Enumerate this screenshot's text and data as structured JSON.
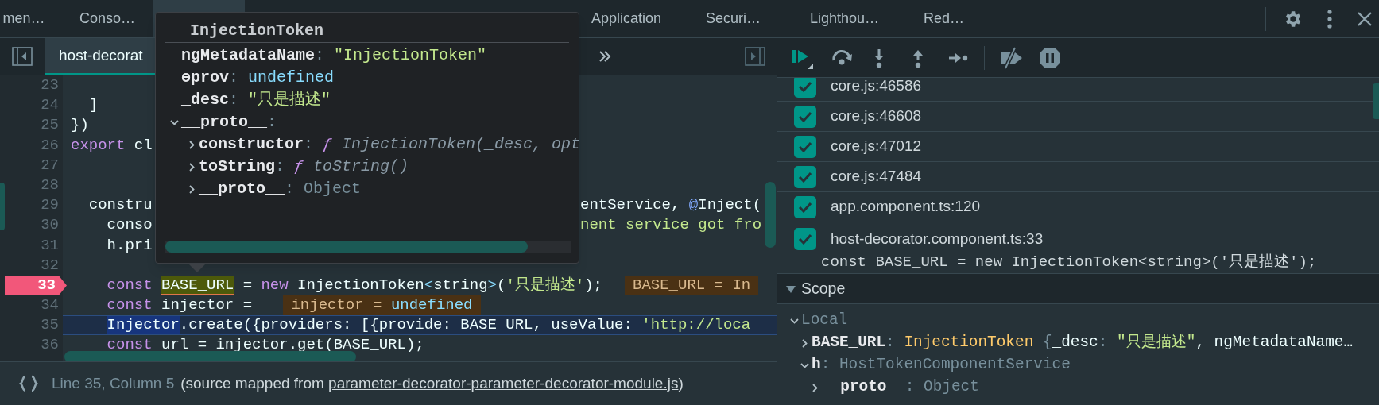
{
  "top_tabs": [
    {
      "label": "men…",
      "selected": false
    },
    {
      "label": "Conso…",
      "selected": false
    },
    {
      "selected": true
    },
    {
      "label": "Application",
      "selected": false
    },
    {
      "label": "Securi…",
      "selected": false
    },
    {
      "label": "Lighthou…",
      "selected": false
    },
    {
      "label": "Red…",
      "selected": false
    }
  ],
  "editor_tabs": [
    {
      "label": "host-decorat",
      "selected": true
    }
  ],
  "code_lines": [
    {
      "number": "23",
      "breakpoint": false,
      "current": false
    },
    {
      "number": "24",
      "breakpoint": false,
      "current": false,
      "segments": [
        {
          "text": "  ]",
          "kind": "plain"
        }
      ]
    },
    {
      "number": "25",
      "breakpoint": false,
      "current": false,
      "segments": [
        {
          "text": "})",
          "kind": "plain"
        }
      ]
    },
    {
      "number": "26",
      "breakpoint": false,
      "current": false,
      "segments": [
        {
          "text": "export",
          "kind": "kw"
        },
        {
          "text": " cl",
          "kind": "plain"
        }
      ]
    },
    {
      "number": "27",
      "breakpoint": false,
      "current": false
    },
    {
      "number": "28",
      "breakpoint": false,
      "current": false
    },
    {
      "number": "29",
      "breakpoint": false,
      "current": false,
      "segments": [
        {
          "text": "  constru",
          "kind": "plain"
        }
      ],
      "right_segments": [
        {
          "text": "entService, ",
          "kind": "plain"
        },
        {
          "text": "@",
          "kind": "deco"
        },
        {
          "text": "Inject(",
          "kind": "plain"
        }
      ]
    },
    {
      "number": "30",
      "breakpoint": false,
      "current": false,
      "segments": [
        {
          "text": "    conso",
          "kind": "plain"
        }
      ],
      "right_segments": [
        {
          "text": "nent service got fro",
          "kind": "str"
        }
      ]
    },
    {
      "number": "31",
      "breakpoint": false,
      "current": false,
      "segments": [
        {
          "text": "    h.pri",
          "kind": "plain"
        }
      ]
    },
    {
      "number": "32",
      "breakpoint": false,
      "current": false
    },
    {
      "number": "33",
      "breakpoint": true,
      "current": false,
      "segments": [
        {
          "text": "    const",
          "kind": "kw"
        },
        {
          "text": " BASE_URL",
          "kind": "match"
        },
        {
          "text": " = ",
          "kind": "plain"
        },
        {
          "text": "new",
          "kind": "kw"
        },
        {
          "text": " InjectionToken",
          "kind": "plain"
        },
        {
          "text": "<",
          "kind": "punc"
        },
        {
          "text": "string",
          "kind": "plain"
        },
        {
          "text": ">",
          "kind": "punc"
        },
        {
          "text": "(",
          "kind": "plain"
        },
        {
          "text": "'只是描述'",
          "kind": "str"
        },
        {
          "text": ");",
          "kind": "plain"
        }
      ],
      "inline_value": [
        {
          "text": "BASE_URL = In",
          "kind": "inline"
        }
      ]
    },
    {
      "number": "34",
      "breakpoint": false,
      "current": false,
      "segments": [
        {
          "text": "    const",
          "kind": "kw"
        },
        {
          "text": " injector = ",
          "kind": "plain"
        }
      ],
      "inline_value": [
        {
          "text": "injector = ",
          "kind": "inline"
        },
        {
          "text": "undefined",
          "kind": "undef"
        }
      ]
    },
    {
      "number": "35",
      "breakpoint": false,
      "current": true,
      "segments": [
        {
          "text": "    Injector",
          "kind": "sel"
        },
        {
          "text": ".create({providers: [{provide: BASE_URL, useValue: ",
          "kind": "plain"
        },
        {
          "text": "'http://loca",
          "kind": "str"
        }
      ]
    },
    {
      "number": "36",
      "breakpoint": false,
      "current": false,
      "segments": [
        {
          "text": "    const",
          "kind": "kw"
        },
        {
          "text": " url = injector.get(BASE_URL);",
          "kind": "plain"
        }
      ]
    }
  ],
  "tooltip": {
    "title": "InjectionToken",
    "properties": [
      {
        "segments": [
          {
            "text": "ngMetadataName",
            "kind": "key"
          },
          {
            "text": ": ",
            "kind": "sep"
          },
          {
            "text": "\"InjectionToken\"",
            "kind": "str"
          }
        ]
      },
      {
        "segments": [
          {
            "text": "ɵprov",
            "kind": "key"
          },
          {
            "text": ": ",
            "kind": "sep"
          },
          {
            "text": "undefined",
            "kind": "undef"
          }
        ]
      },
      {
        "segments": [
          {
            "text": "_desc",
            "kind": "key"
          },
          {
            "text": ": ",
            "kind": "sep"
          },
          {
            "text": "\"只是描述\"",
            "kind": "str"
          }
        ]
      },
      {
        "segments": [
          {
            "text": "__proto__",
            "kind": "key"
          },
          {
            "text": ":",
            "kind": "sep"
          }
        ],
        "expanded": true,
        "children": [
          {
            "segments": [
              {
                "text": "constructor",
                "kind": "key"
              },
              {
                "text": ": ",
                "kind": "sep"
              },
              {
                "text": "ƒ ",
                "kind": "fn"
              },
              {
                "text": "InjectionToken(_desc, opt",
                "kind": "fnname"
              }
            ],
            "expanded": false
          },
          {
            "segments": [
              {
                "text": "toString",
                "kind": "key"
              },
              {
                "text": ": ",
                "kind": "sep"
              },
              {
                "text": "ƒ ",
                "kind": "fn"
              },
              {
                "text": "toString()",
                "kind": "fnname"
              }
            ],
            "expanded": false
          },
          {
            "segments": [
              {
                "text": "__proto__",
                "kind": "key"
              },
              {
                "text": ": ",
                "kind": "sep"
              },
              {
                "text": "Object",
                "kind": "obj"
              }
            ],
            "expanded": false
          }
        ]
      }
    ]
  },
  "status_bar": {
    "position": "Line 35, Column 5",
    "source_prefix": "(source mapped from ",
    "source_link": "parameter-decorator-parameter-decorator-module.js",
    "source_suffix": ")"
  },
  "breakpoints": [
    {
      "label": "core.js:46586",
      "checked": true
    },
    {
      "label": "core.js:46608",
      "checked": true
    },
    {
      "label": "core.js:47012",
      "checked": true
    },
    {
      "label": "core.js:47484",
      "checked": true
    },
    {
      "label": "app.component.ts:120",
      "checked": true
    },
    {
      "label": "host-decorator.component.ts:33",
      "checked": true,
      "snippet": "const BASE_URL = new InjectionToken<string>('只是描述');"
    }
  ],
  "scope": {
    "title": "Scope",
    "expanded": true,
    "items": [
      {
        "segments": [
          {
            "text": "Local",
            "kind": "obj"
          }
        ],
        "expanded": true,
        "children": [
          {
            "segments": [
              {
                "text": "BASE_URL",
                "kind": "key"
              },
              {
                "text": ": ",
                "kind": "sep"
              },
              {
                "text": "InjectionToken",
                "kind": "type"
              },
              {
                "text": " {",
                "kind": "sep"
              },
              {
                "text": "_desc",
                "kind": "plain"
              },
              {
                "text": ": ",
                "kind": "sep"
              },
              {
                "text": "\"只是描述\"",
                "kind": "str"
              },
              {
                "text": ", ngMetadataName…",
                "kind": "plain"
              }
            ],
            "expanded": false
          },
          {
            "segments": [
              {
                "text": "h",
                "kind": "key"
              },
              {
                "text": ": ",
                "kind": "sep"
              },
              {
                "text": "HostTokenComponentService",
                "kind": "obj"
              }
            ],
            "expanded": true,
            "children": [
              {
                "segments": [
                  {
                    "text": "__proto__",
                    "kind": "key"
                  },
                  {
                    "text": ": ",
                    "kind": "sep"
                  },
                  {
                    "text": "Object",
                    "kind": "obj"
                  }
                ],
                "expanded": false
              }
            ]
          }
        ]
      }
    ]
  }
}
